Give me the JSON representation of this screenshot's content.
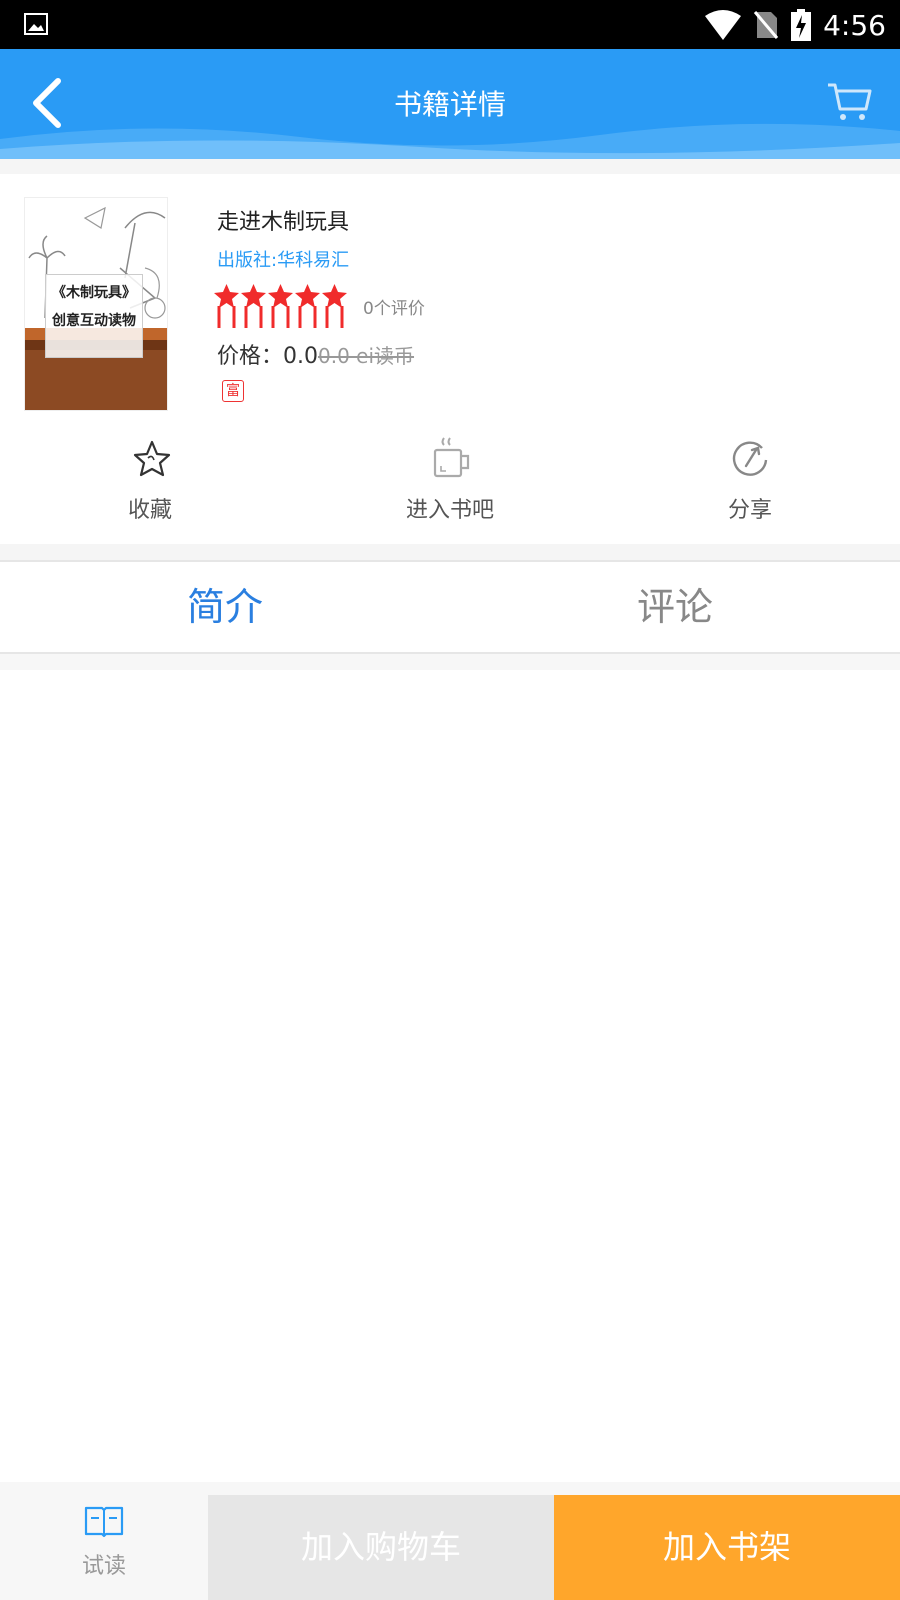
{
  "status_bar": {
    "time": "4:56"
  },
  "header": {
    "title": "书籍详情"
  },
  "book": {
    "name": "走进木制玩具",
    "publisher": "出版社:华科易汇",
    "cover_title_line1": "《木制玩具》",
    "cover_title_line2": "创意互动读物",
    "star_count": 5,
    "rating_count": "0个评价",
    "price_label": "价格：0.0",
    "price_old": "0.0  ei读币",
    "badge": "富"
  },
  "actions": [
    {
      "label": "收藏",
      "icon": "star-outline-icon"
    },
    {
      "label": "进入书吧",
      "icon": "coffee-cup-icon"
    },
    {
      "label": "分享",
      "icon": "share-icon"
    }
  ],
  "tabs": [
    {
      "label": "简介",
      "active": true
    },
    {
      "label": "评论",
      "active": false
    }
  ],
  "footer": {
    "try_read": "试读",
    "add_cart": "加入购物车",
    "add_shelf": "加入书架"
  },
  "colors": {
    "header_blue": "#2a9bf5",
    "tab_active": "#2a7fe0",
    "shelf_orange": "#ffa62b",
    "star_red": "#f02b2b"
  }
}
